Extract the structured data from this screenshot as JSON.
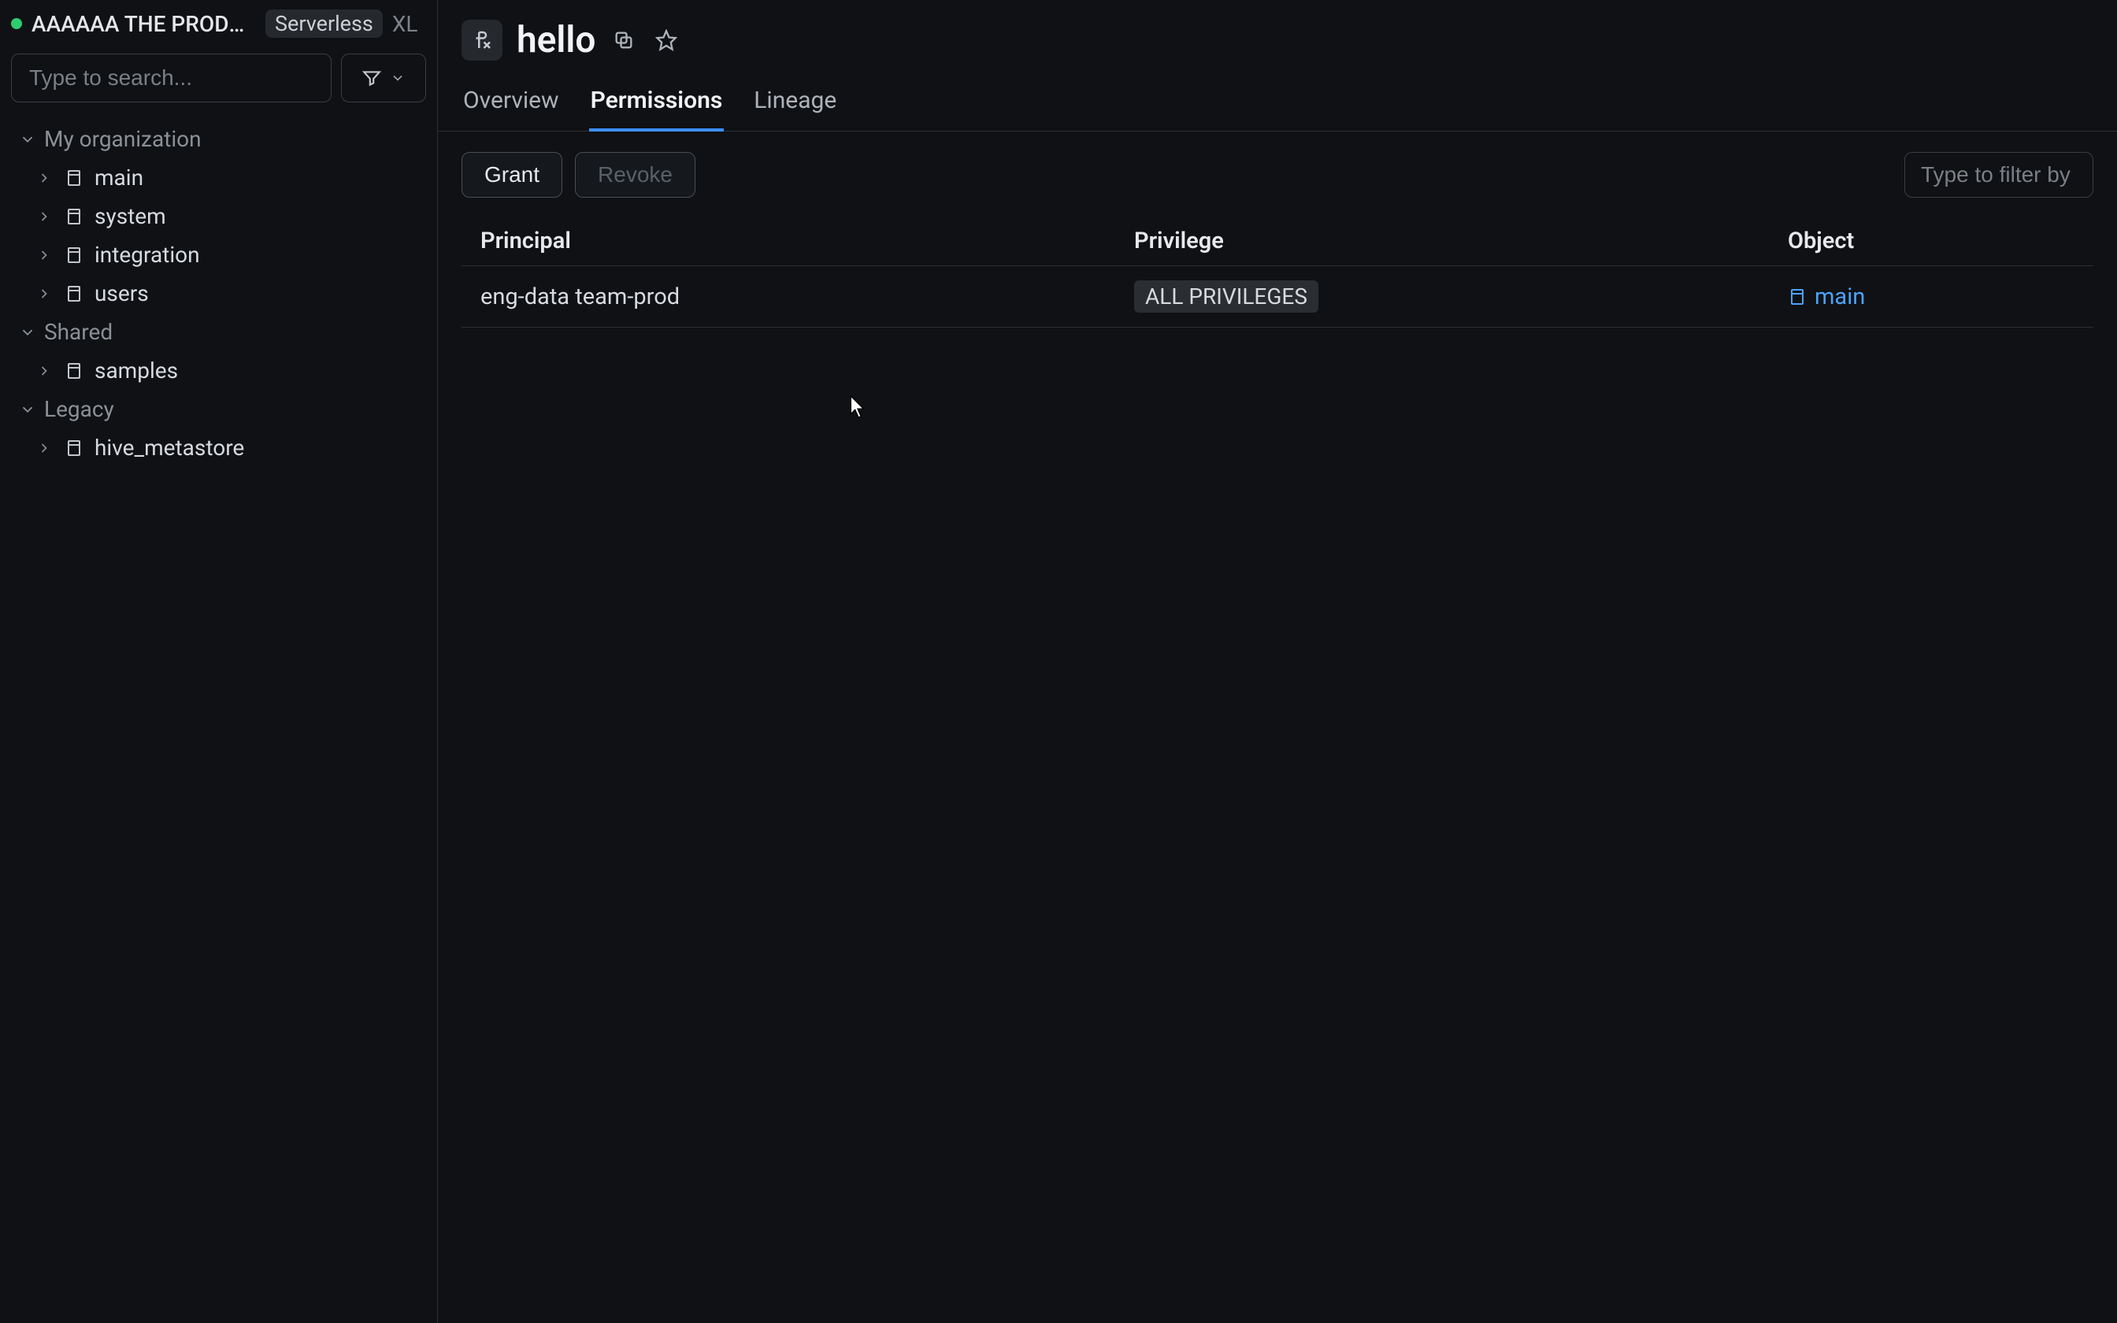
{
  "sidebar": {
    "project_label": "AAAAAA THE PRODU…",
    "serverless_chip": "Serverless",
    "size": "XL",
    "search_placeholder": "Type to search...",
    "groups": [
      {
        "label": "My organization",
        "items": [
          {
            "name": "main"
          },
          {
            "name": "system"
          },
          {
            "name": "integration"
          },
          {
            "name": "users"
          }
        ]
      },
      {
        "label": "Shared",
        "items": [
          {
            "name": "samples"
          }
        ]
      },
      {
        "label": "Legacy",
        "items": [
          {
            "name": "hive_metastore"
          }
        ]
      }
    ]
  },
  "header": {
    "title": "hello"
  },
  "tabs": {
    "items": [
      {
        "label": "Overview",
        "active": false
      },
      {
        "label": "Permissions",
        "active": true
      },
      {
        "label": "Lineage",
        "active": false
      }
    ]
  },
  "toolbar": {
    "grant": "Grant",
    "revoke": "Revoke",
    "filter_placeholder": "Type to filter by pr"
  },
  "table": {
    "columns": {
      "principal": "Principal",
      "privilege": "Privilege",
      "object": "Object"
    },
    "rows": [
      {
        "principal": "eng-data team-prod",
        "privilege": "ALL PRIVILEGES",
        "object": "main"
      }
    ]
  }
}
